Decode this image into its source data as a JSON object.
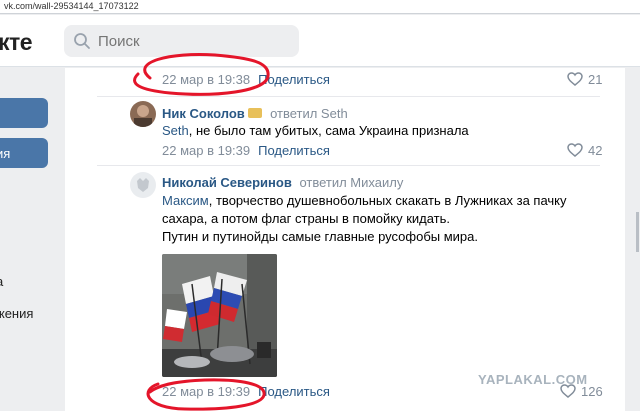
{
  "browser": {
    "url": "vk.com/wall-29534144_17073122"
  },
  "header": {
    "logo": "кте",
    "search_placeholder": "Поиск"
  },
  "sidebar": {
    "item2_label": "ия",
    "item3_label": "а",
    "item4_label": "жения"
  },
  "comments": [
    {
      "date": "22 мар в 19:38",
      "share": "Поделиться",
      "likes": "21"
    },
    {
      "author": "Ник Соколов",
      "reply_to": "ответил Seth",
      "mention": "Seth",
      "text": ", не было там убитых, сама Украина признала",
      "date": "22 мар в 19:39",
      "share": "Поделиться",
      "likes": "42"
    },
    {
      "author": "Николай Северинов",
      "reply_to": "ответил Михаилу",
      "mention": "Максим",
      "text_line1": ", творчество душевнобольных скакать в Лужниках за пачку",
      "text_line2": "сахара, а потом флаг страны в помойку кидать.",
      "text_line3": "Путин и путинойды самые главные русофобы мира.",
      "date": "22 мар в 19:39",
      "share": "Поделиться",
      "likes": "126"
    }
  ],
  "watermark": "YAPLAKAL.COM",
  "colors": {
    "accent": "#4a76a8",
    "link": "#2a5885",
    "muted": "#818c99",
    "annotation": "#e4152a"
  },
  "icons": [
    "search-icon",
    "heart-icon"
  ]
}
